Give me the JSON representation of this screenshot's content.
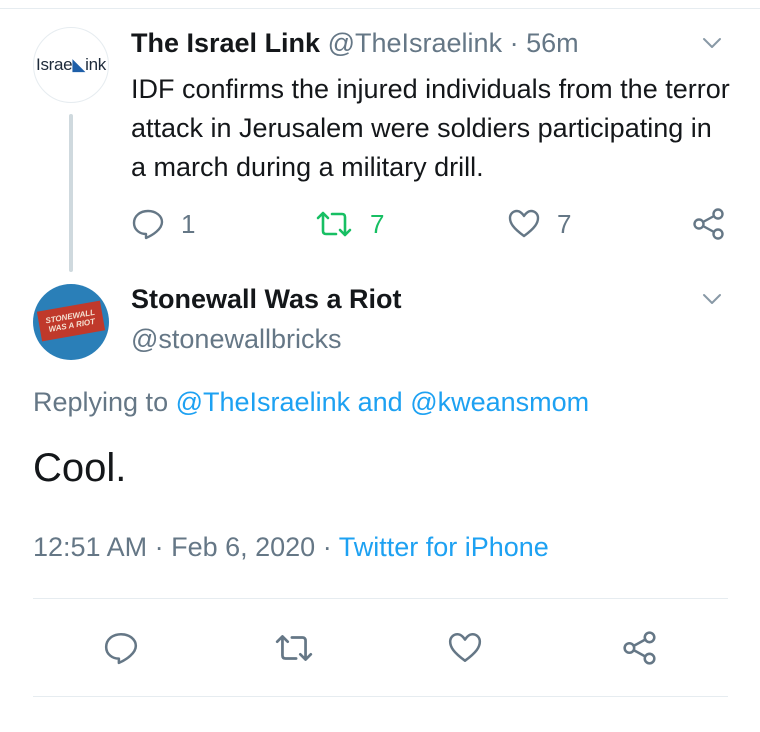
{
  "parent_tweet": {
    "avatar_text": "Israelink",
    "display_name": "The Israel Link",
    "handle": "@TheIsraelink",
    "separator": "·",
    "time": "56m",
    "text": "IDF confirms the injured individuals from the terror attack in Jerusalem were soldiers participating in a march during a military drill.",
    "replies": "1",
    "retweets": "7",
    "likes": "7"
  },
  "reply_tweet": {
    "avatar_text": [
      "STONEWALL",
      "WAS A RIOT"
    ],
    "display_name": "Stonewall Was a Riot",
    "handle": "@stonewallbricks",
    "replying_prefix": "Replying to",
    "replying_user1": "@TheIsraelink",
    "replying_and": "and",
    "replying_user2": "@kweansmom",
    "text": "Cool.",
    "timestamp": "12:51 AM · Feb 6, 2020",
    "meta_separator": "·",
    "source": "Twitter for iPhone"
  },
  "icons": {
    "reply": "reply-icon",
    "retweet": "retweet-icon",
    "like": "heart-icon",
    "share": "share-icon",
    "menu": "chevron-down-icon"
  },
  "colors": {
    "text_primary": "#14171a",
    "text_secondary": "#657786",
    "link": "#1da1f2",
    "retweet_active": "#17bf63",
    "divider": "#e6ecf0",
    "thread_line": "#cfd9de"
  }
}
